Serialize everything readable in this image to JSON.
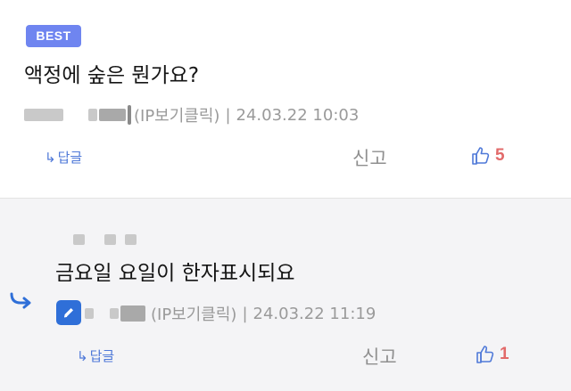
{
  "comments": [
    {
      "badge": "BEST",
      "text": "액정에 숲은 뭔가요?",
      "ip_label": "(IP보기클릭)",
      "separator": "|",
      "date": "24.03.22 10:03",
      "reply_label": "답글",
      "report_label": "신고",
      "like_count": "5"
    },
    {
      "text": "금요일 요일이 한자표시되요",
      "ip_label": "(IP보기클릭)",
      "separator": "|",
      "date": "24.03.22 11:19",
      "reply_label": "답글",
      "report_label": "신고",
      "like_count": "1"
    }
  ],
  "icons": {
    "reply_arrow": "reply-arrow-icon",
    "thumbs_up": "thumbs-up-icon",
    "edit": "pencil-icon"
  },
  "colors": {
    "best_badge": "#6f85f0",
    "link": "#4f79d8",
    "like_count": "#e26a6a",
    "edit_badge": "#2f6fd8",
    "reply_background": "#f4f4f6"
  }
}
